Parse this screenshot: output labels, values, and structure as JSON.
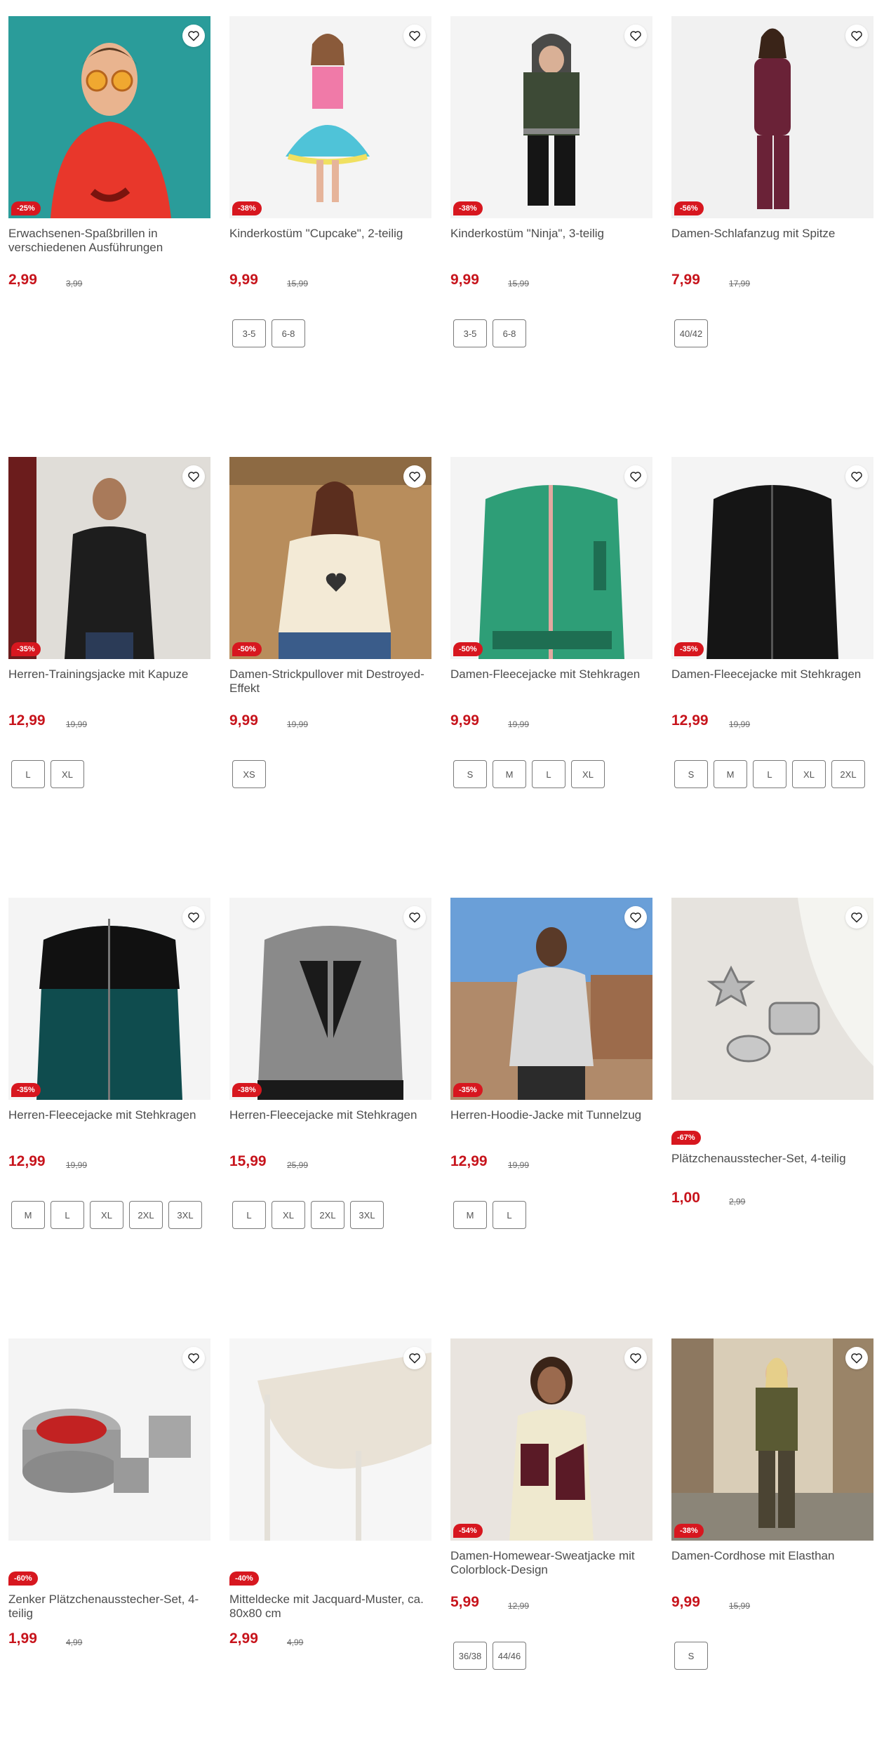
{
  "products": [
    {
      "title": "Erwachsenen-Spaßbrillen in verschiedenen Ausführungen",
      "discount": "-25%",
      "price": "2,99",
      "old_price": "3,99",
      "sizes": [],
      "scene": "party-glasses"
    },
    {
      "title": "Kinderkostüm \"Cupcake\", 2-teilig",
      "discount": "-38%",
      "price": "9,99",
      "old_price": "15,99",
      "sizes": [
        "3-5",
        "6-8"
      ],
      "scene": "cupcake-costume"
    },
    {
      "title": "Kinderkostüm \"Ninja\", 3-teilig",
      "discount": "-38%",
      "price": "9,99",
      "old_price": "15,99",
      "sizes": [
        "3-5",
        "6-8"
      ],
      "scene": "ninja-costume"
    },
    {
      "title": "Damen-Schlafanzug mit Spitze",
      "discount": "-56%",
      "price": "7,99",
      "old_price": "17,99",
      "sizes": [
        "40/42"
      ],
      "scene": "pajamas"
    },
    {
      "title": "Herren-Trainingsjacke mit Kapuze",
      "discount": "-35%",
      "price": "12,99",
      "old_price": "19,99",
      "sizes": [
        "L",
        "XL"
      ],
      "scene": "training-jacket"
    },
    {
      "title": "Damen-Strickpullover mit Destroyed-Effekt",
      "discount": "-50%",
      "price": "9,99",
      "old_price": "19,99",
      "sizes": [
        "XS"
      ],
      "scene": "knit-sweater"
    },
    {
      "title": "Damen-Fleecejacke mit Stehkragen",
      "discount": "-50%",
      "price": "9,99",
      "old_price": "19,99",
      "sizes": [
        "S",
        "M",
        "L",
        "XL"
      ],
      "scene": "fleece-green"
    },
    {
      "title": "Damen-Fleecejacke mit Stehkragen",
      "discount": "-35%",
      "price": "12,99",
      "old_price": "19,99",
      "sizes": [
        "S",
        "M",
        "L",
        "XL",
        "2XL"
      ],
      "scene": "fleece-black"
    },
    {
      "title": "Herren-Fleecejacke mit Stehkragen",
      "discount": "-35%",
      "price": "12,99",
      "old_price": "19,99",
      "sizes": [
        "M",
        "L",
        "XL",
        "2XL",
        "3XL"
      ],
      "scene": "fleece-teal"
    },
    {
      "title": "Herren-Fleecejacke mit Stehkragen",
      "discount": "-38%",
      "price": "15,99",
      "old_price": "25,99",
      "sizes": [
        "L",
        "XL",
        "2XL",
        "3XL"
      ],
      "scene": "fleece-grey"
    },
    {
      "title": "Herren-Hoodie-Jacke mit Tunnelzug",
      "discount": "-35%",
      "price": "12,99",
      "old_price": "19,99",
      "sizes": [
        "M",
        "L"
      ],
      "scene": "hoodie-jacket"
    },
    {
      "title": "Plätzchenausstecher-Set, 4-teilig",
      "discount": "-67%",
      "price": "1,00",
      "old_price": "2,99",
      "sizes": [],
      "badge_below": true,
      "scene": "cookie-cutters"
    },
    {
      "title": "Zenker Plätzchenausstecher-Set, 4-teilig",
      "discount": "-60%",
      "price": "1,99",
      "old_price": "4,99",
      "sizes": [],
      "badge_below": true,
      "scene": "zenker-cutters"
    },
    {
      "title": "Mitteldecke mit Jacquard-Muster, ca. 80x80 cm",
      "discount": "-40%",
      "price": "2,99",
      "old_price": "4,99",
      "sizes": [],
      "badge_below": true,
      "scene": "table-cloth"
    },
    {
      "title": "Damen-Homewear-Sweatjacke mit Colorblock-Design",
      "discount": "-54%",
      "price": "5,99",
      "old_price": "12,99",
      "sizes": [
        "36/38",
        "44/46"
      ],
      "scene": "homewear"
    },
    {
      "title": "Damen-Cordhose mit Elasthan",
      "discount": "-38%",
      "price": "9,99",
      "old_price": "15,99",
      "sizes": [
        "S"
      ],
      "scene": "cord-trousers"
    }
  ],
  "colors": {
    "price": "#c7141c",
    "badge": "#d7171f"
  },
  "icons": {
    "favorite": "heart-outline-icon"
  }
}
